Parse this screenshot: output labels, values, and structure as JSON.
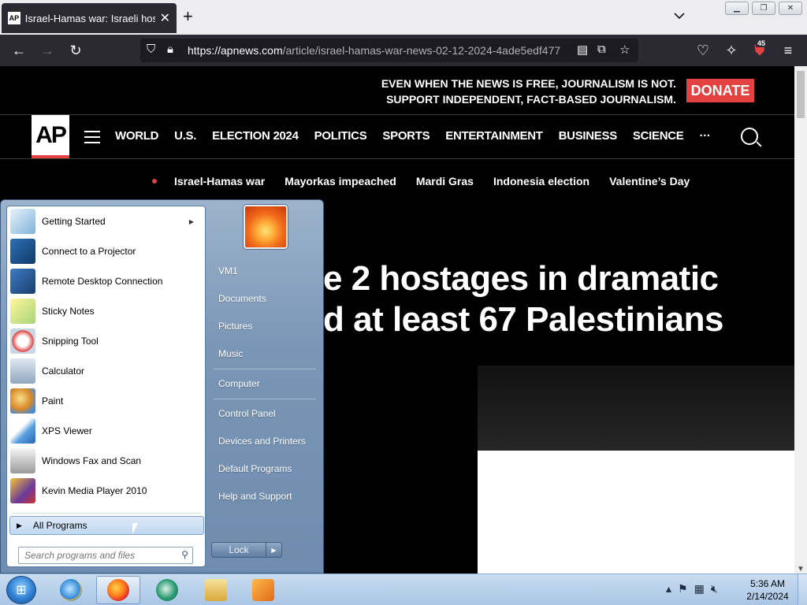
{
  "browser": {
    "tab_title": "Israel-Hamas war: Israeli hostag",
    "tab_favicon_text": "AP",
    "url_main": "https://apnews.com",
    "url_path": "/article/israel-hamas-war-news-02-12-2024-4ade5edf477",
    "extension_badge": "45"
  },
  "page": {
    "promo_line1": "EVEN WHEN THE NEWS IS FREE, JOURNALISM IS NOT.",
    "promo_line2": "SUPPORT INDEPENDENT, FACT-BASED JOURNALISM.",
    "donate_label": "DONATE",
    "logo_text": "AP",
    "nav": [
      "WORLD",
      "U.S.",
      "ELECTION 2024",
      "POLITICS",
      "SPORTS",
      "ENTERTAINMENT",
      "BUSINESS",
      "SCIENCE",
      "···"
    ],
    "trending": [
      "Israel-Hamas war",
      "Mayorkas impeached",
      "Mardi Gras",
      "Indonesia election",
      "Valentine’s Day"
    ],
    "headline_line1": "e 2 hostages in dramatic",
    "headline_line2": "d at least 67 Palestinians"
  },
  "start_menu": {
    "programs": [
      {
        "label": "Getting Started",
        "icon": "getting-started-icon",
        "has_submenu": true
      },
      {
        "label": "Connect to a Projector",
        "icon": "projector-icon"
      },
      {
        "label": "Remote Desktop Connection",
        "icon": "remote-desktop-icon"
      },
      {
        "label": "Sticky Notes",
        "icon": "sticky-notes-icon"
      },
      {
        "label": "Snipping Tool",
        "icon": "snipping-tool-icon"
      },
      {
        "label": "Calculator",
        "icon": "calculator-icon"
      },
      {
        "label": "Paint",
        "icon": "paint-icon"
      },
      {
        "label": "XPS Viewer",
        "icon": "xps-viewer-icon"
      },
      {
        "label": "Windows Fax and Scan",
        "icon": "fax-scan-icon"
      },
      {
        "label": "Kevin Media Player 2010",
        "icon": "media-player-icon"
      }
    ],
    "all_programs_label": "All Programs",
    "search_placeholder": "Search programs and files",
    "right_items": [
      "VM1",
      "Documents",
      "Pictures",
      "Music",
      "Computer",
      "Control Panel",
      "Devices and Printers",
      "Default Programs",
      "Help and Support"
    ],
    "lock_label": "Lock"
  },
  "taskbar": {
    "time": "5:36 AM",
    "date": "2/14/2024"
  },
  "colors": {
    "ap_red": "#e44141",
    "firefox_dark": "#2b2a33"
  }
}
